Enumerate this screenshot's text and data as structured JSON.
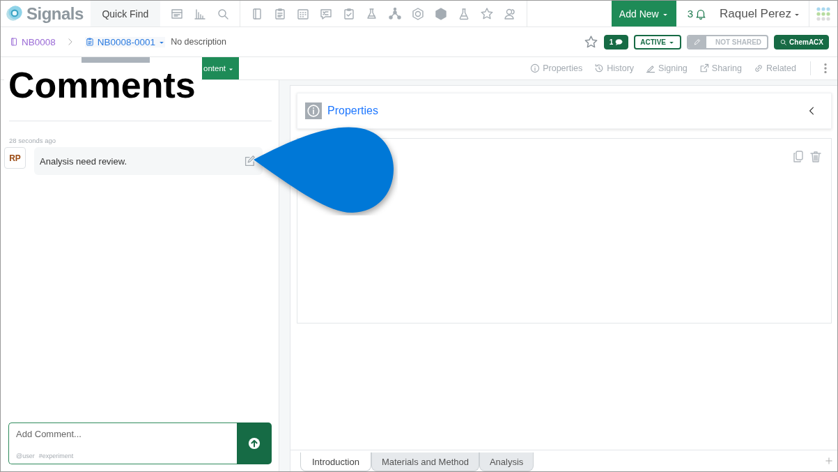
{
  "header": {
    "logo": "Signals",
    "quick_find": "Quick Find",
    "add_new": "Add New",
    "notification_count": "3",
    "user": "Raquel Perez"
  },
  "breadcrumb": {
    "notebook": "NB0008",
    "experiment": "NB0008-0001",
    "description": "No description"
  },
  "status": {
    "comment_count": "1",
    "state": "ACTIVE",
    "sharing": "NOT SHARED",
    "search": "ChemACX"
  },
  "toolbar": {
    "content_button": "ontent",
    "actions": [
      "Properties",
      "History",
      "Signing",
      "Sharing",
      "Related"
    ]
  },
  "callout": "Comments",
  "comments": [
    {
      "time": "28 seconds ago",
      "initials": "RP",
      "text": "Analysis need review."
    }
  ],
  "comment_input": {
    "placeholder": "Add Comment...",
    "hints": [
      "@user",
      "#experiment"
    ]
  },
  "properties_panel": {
    "title": "Properties"
  },
  "section_tabs": [
    {
      "label": "Introduction",
      "selected": true
    },
    {
      "label": "Materials and Method",
      "selected": false
    },
    {
      "label": "Analysis",
      "selected": false
    }
  ]
}
